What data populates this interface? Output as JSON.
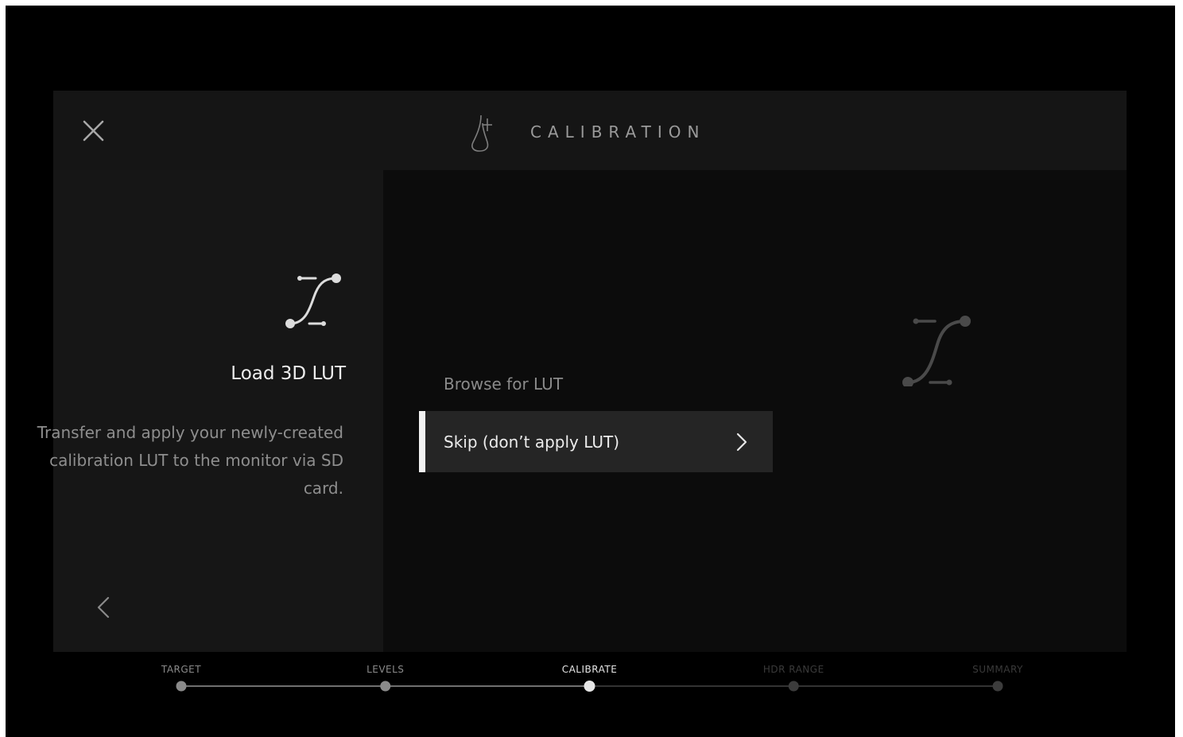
{
  "header": {
    "title": "CALIBRATION",
    "close_icon": "close-icon",
    "logo_icon": "app-logo-icon"
  },
  "left_panel": {
    "icon": "lut-curve-icon",
    "title": "Load 3D LUT",
    "description": "Transfer and apply your newly-created calibration LUT to the monitor via SD card.",
    "back_icon": "chevron-left-icon"
  },
  "options": {
    "browse": "Browse for LUT",
    "skip": "Skip (don’t apply LUT)",
    "skip_icon": "chevron-right-icon",
    "selected": "skip"
  },
  "stepper": {
    "steps": [
      {
        "label": "TARGET",
        "state": "done"
      },
      {
        "label": "LEVELS",
        "state": "done"
      },
      {
        "label": "CALIBRATE",
        "state": "current"
      },
      {
        "label": "HDR RANGE",
        "state": "upcoming"
      },
      {
        "label": "SUMMARY",
        "state": "upcoming"
      }
    ]
  },
  "colors": {
    "background": "#000000",
    "header": "#151515",
    "left_panel": "#161616",
    "main_panel": "#0c0c0c",
    "selected_row": "#252525",
    "accent": "#f2f2f2",
    "text_primary": "#ededed",
    "text_secondary": "#8e8e8e"
  }
}
